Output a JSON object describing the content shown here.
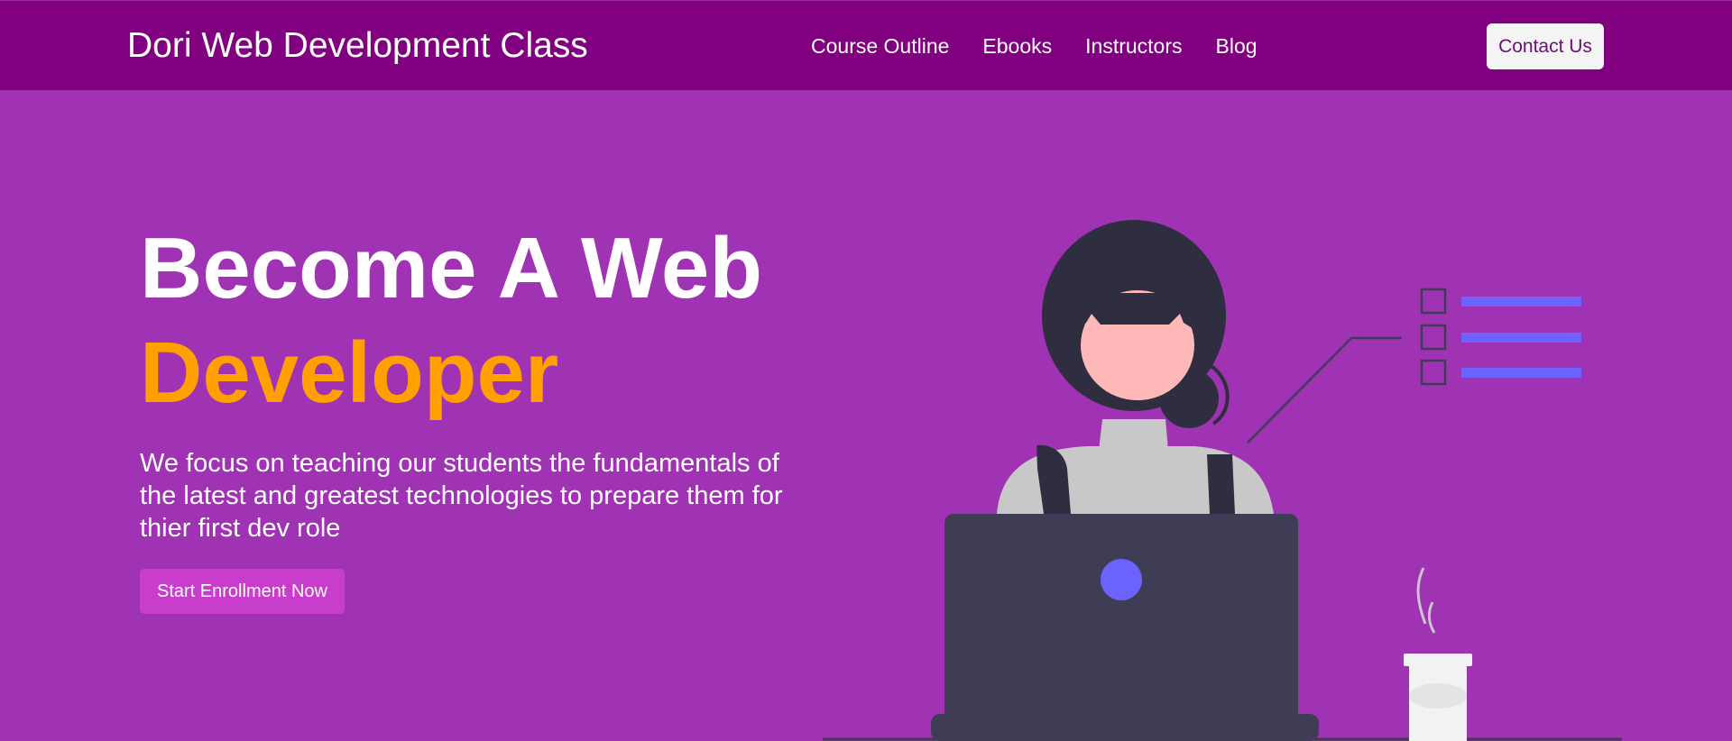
{
  "header": {
    "brand": "Dori Web Development Class",
    "nav": [
      {
        "label": "Course Outline"
      },
      {
        "label": "Ebooks"
      },
      {
        "label": "Instructors"
      },
      {
        "label": "Blog"
      }
    ],
    "contact_label": "Contact Us"
  },
  "hero": {
    "title_line1": "Become A Web",
    "title_line2": "Developer",
    "description": "We focus on teaching our students the fundamentals of the latest and greatest technologies to prepare them for thier first dev role",
    "cta_label": "Start Enrollment Now",
    "illustration": "woman-at-laptop-illustration"
  },
  "colors": {
    "navbar_bg": "#800080",
    "page_bg": "#a033b3",
    "accent_orange": "#ff9f00",
    "cta_bg": "#c93dcc",
    "checklist_blue": "#6c63ff"
  }
}
